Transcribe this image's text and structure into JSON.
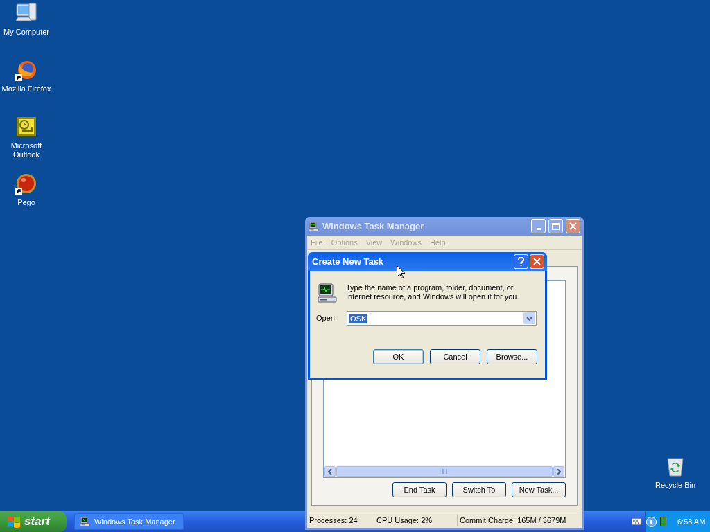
{
  "desktop_icons": [
    {
      "label": "My Computer",
      "shortcut": false
    },
    {
      "label": "Mozilla Firefox",
      "shortcut": true
    },
    {
      "label": "Microsoft Outlook",
      "shortcut": false
    },
    {
      "label": "Pego",
      "shortcut": true
    }
  ],
  "recycle_bin": {
    "label": "Recycle Bin"
  },
  "task_manager": {
    "title": "Windows Task Manager",
    "active": false,
    "menu": [
      {
        "label": "File",
        "disabled": true
      },
      {
        "label": "Options",
        "disabled": true
      },
      {
        "label": "View",
        "disabled": true
      },
      {
        "label": "Windows",
        "disabled": true
      },
      {
        "label": "Help",
        "disabled": true
      }
    ],
    "buttons": [
      "End Task",
      "Switch To",
      "New Task..."
    ],
    "status_bar": [
      "Processes: 24",
      "CPU Usage: 2%",
      "Commit Charge: 165M / 3679M"
    ]
  },
  "dialog": {
    "title": "Create New Task",
    "active": true,
    "message": "Type the name of a program, folder, document, or Internet resource, and Windows will open it for you.",
    "open_label": "Open:",
    "open_value": "OSK",
    "value_selected": true,
    "buttons": [
      {
        "label": "OK",
        "focused": true
      },
      {
        "label": "Cancel",
        "focused": false
      },
      {
        "label": "Browse...",
        "focused": false
      }
    ]
  },
  "taskbar": {
    "start": "start",
    "tasks": [
      {
        "label": "Windows Task Manager",
        "selected": false
      }
    ],
    "clock": "6:58 AM"
  }
}
